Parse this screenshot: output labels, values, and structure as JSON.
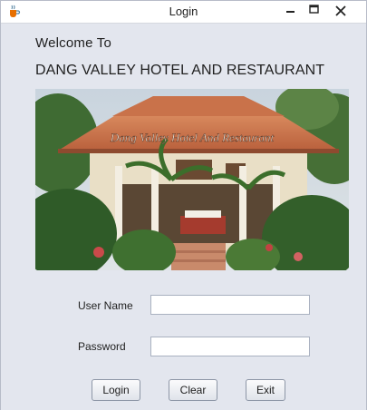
{
  "window": {
    "title": "Login",
    "icon": "java-coffee-icon",
    "controls": [
      "minimize-icon",
      "maximize-icon",
      "close-icon"
    ]
  },
  "header": {
    "welcome": "Welcome To",
    "hotel_name": "DANG VALLEY HOTEL AND RESTAURANT"
  },
  "photo": {
    "overlay_text": "Dang Valley Hotel And Restaurant"
  },
  "form": {
    "username_label": "User Name",
    "username_value": "",
    "password_label": "Password",
    "password_value": ""
  },
  "buttons": {
    "login": "Login",
    "clear": "Clear",
    "exit": "Exit"
  }
}
